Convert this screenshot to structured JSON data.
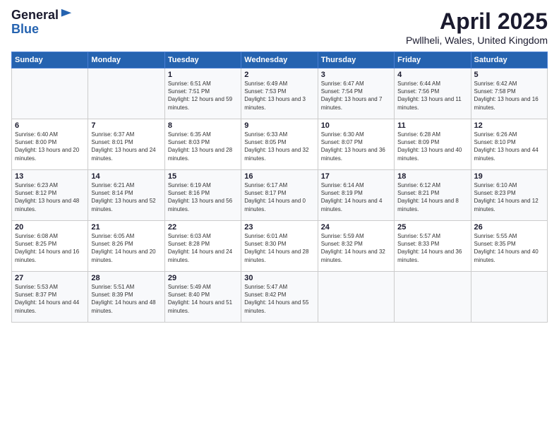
{
  "logo": {
    "general": "General",
    "blue": "Blue"
  },
  "title": "April 2025",
  "subtitle": "Pwllheli, Wales, United Kingdom",
  "days_of_week": [
    "Sunday",
    "Monday",
    "Tuesday",
    "Wednesday",
    "Thursday",
    "Friday",
    "Saturday"
  ],
  "weeks": [
    [
      {
        "day": "",
        "info": ""
      },
      {
        "day": "",
        "info": ""
      },
      {
        "day": "1",
        "info": "Sunrise: 6:51 AM\nSunset: 7:51 PM\nDaylight: 12 hours and 59 minutes."
      },
      {
        "day": "2",
        "info": "Sunrise: 6:49 AM\nSunset: 7:53 PM\nDaylight: 13 hours and 3 minutes."
      },
      {
        "day": "3",
        "info": "Sunrise: 6:47 AM\nSunset: 7:54 PM\nDaylight: 13 hours and 7 minutes."
      },
      {
        "day": "4",
        "info": "Sunrise: 6:44 AM\nSunset: 7:56 PM\nDaylight: 13 hours and 11 minutes."
      },
      {
        "day": "5",
        "info": "Sunrise: 6:42 AM\nSunset: 7:58 PM\nDaylight: 13 hours and 16 minutes."
      }
    ],
    [
      {
        "day": "6",
        "info": "Sunrise: 6:40 AM\nSunset: 8:00 PM\nDaylight: 13 hours and 20 minutes."
      },
      {
        "day": "7",
        "info": "Sunrise: 6:37 AM\nSunset: 8:01 PM\nDaylight: 13 hours and 24 minutes."
      },
      {
        "day": "8",
        "info": "Sunrise: 6:35 AM\nSunset: 8:03 PM\nDaylight: 13 hours and 28 minutes."
      },
      {
        "day": "9",
        "info": "Sunrise: 6:33 AM\nSunset: 8:05 PM\nDaylight: 13 hours and 32 minutes."
      },
      {
        "day": "10",
        "info": "Sunrise: 6:30 AM\nSunset: 8:07 PM\nDaylight: 13 hours and 36 minutes."
      },
      {
        "day": "11",
        "info": "Sunrise: 6:28 AM\nSunset: 8:09 PM\nDaylight: 13 hours and 40 minutes."
      },
      {
        "day": "12",
        "info": "Sunrise: 6:26 AM\nSunset: 8:10 PM\nDaylight: 13 hours and 44 minutes."
      }
    ],
    [
      {
        "day": "13",
        "info": "Sunrise: 6:23 AM\nSunset: 8:12 PM\nDaylight: 13 hours and 48 minutes."
      },
      {
        "day": "14",
        "info": "Sunrise: 6:21 AM\nSunset: 8:14 PM\nDaylight: 13 hours and 52 minutes."
      },
      {
        "day": "15",
        "info": "Sunrise: 6:19 AM\nSunset: 8:16 PM\nDaylight: 13 hours and 56 minutes."
      },
      {
        "day": "16",
        "info": "Sunrise: 6:17 AM\nSunset: 8:17 PM\nDaylight: 14 hours and 0 minutes."
      },
      {
        "day": "17",
        "info": "Sunrise: 6:14 AM\nSunset: 8:19 PM\nDaylight: 14 hours and 4 minutes."
      },
      {
        "day": "18",
        "info": "Sunrise: 6:12 AM\nSunset: 8:21 PM\nDaylight: 14 hours and 8 minutes."
      },
      {
        "day": "19",
        "info": "Sunrise: 6:10 AM\nSunset: 8:23 PM\nDaylight: 14 hours and 12 minutes."
      }
    ],
    [
      {
        "day": "20",
        "info": "Sunrise: 6:08 AM\nSunset: 8:25 PM\nDaylight: 14 hours and 16 minutes."
      },
      {
        "day": "21",
        "info": "Sunrise: 6:05 AM\nSunset: 8:26 PM\nDaylight: 14 hours and 20 minutes."
      },
      {
        "day": "22",
        "info": "Sunrise: 6:03 AM\nSunset: 8:28 PM\nDaylight: 14 hours and 24 minutes."
      },
      {
        "day": "23",
        "info": "Sunrise: 6:01 AM\nSunset: 8:30 PM\nDaylight: 14 hours and 28 minutes."
      },
      {
        "day": "24",
        "info": "Sunrise: 5:59 AM\nSunset: 8:32 PM\nDaylight: 14 hours and 32 minutes."
      },
      {
        "day": "25",
        "info": "Sunrise: 5:57 AM\nSunset: 8:33 PM\nDaylight: 14 hours and 36 minutes."
      },
      {
        "day": "26",
        "info": "Sunrise: 5:55 AM\nSunset: 8:35 PM\nDaylight: 14 hours and 40 minutes."
      }
    ],
    [
      {
        "day": "27",
        "info": "Sunrise: 5:53 AM\nSunset: 8:37 PM\nDaylight: 14 hours and 44 minutes."
      },
      {
        "day": "28",
        "info": "Sunrise: 5:51 AM\nSunset: 8:39 PM\nDaylight: 14 hours and 48 minutes."
      },
      {
        "day": "29",
        "info": "Sunrise: 5:49 AM\nSunset: 8:40 PM\nDaylight: 14 hours and 51 minutes."
      },
      {
        "day": "30",
        "info": "Sunrise: 5:47 AM\nSunset: 8:42 PM\nDaylight: 14 hours and 55 minutes."
      },
      {
        "day": "",
        "info": ""
      },
      {
        "day": "",
        "info": ""
      },
      {
        "day": "",
        "info": ""
      }
    ]
  ]
}
